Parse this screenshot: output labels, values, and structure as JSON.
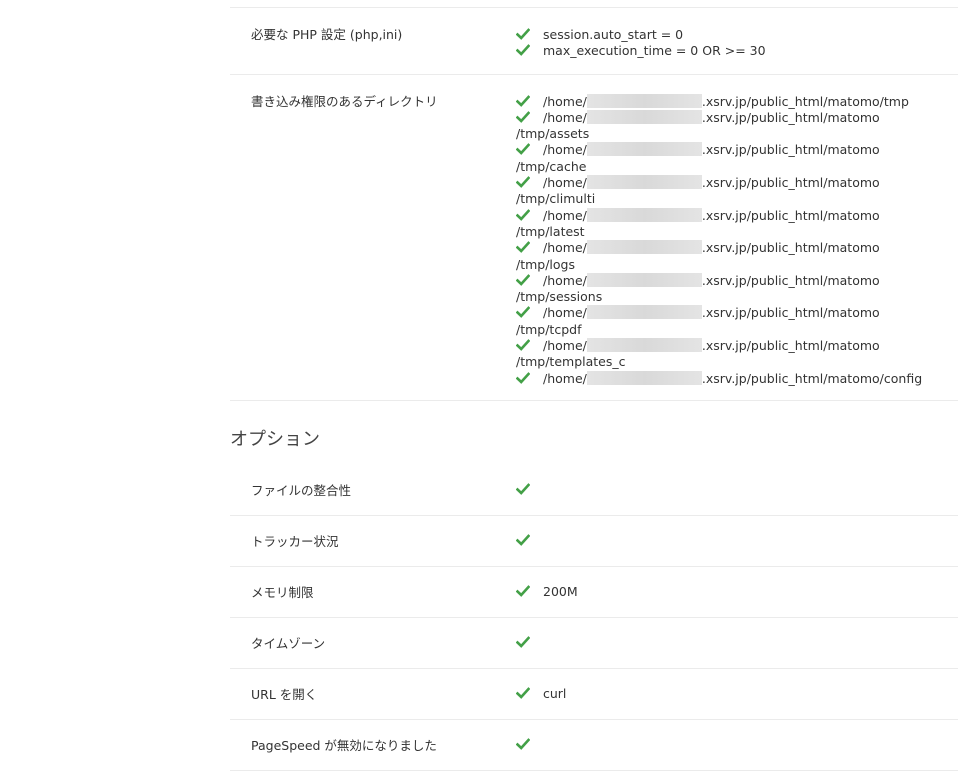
{
  "php_settings": {
    "label": "必要な PHP 設定 (php,ini)",
    "items": [
      "session.auto_start = 0",
      "max_execution_time = 0 OR >= 30"
    ]
  },
  "writable_dirs": {
    "label": "書き込み権限のあるディレクトリ",
    "prefix": "/home/",
    "items": [
      {
        "suffix": ".xsrv.jp/public_html/matomo/tmp",
        "cont": ""
      },
      {
        "suffix": ".xsrv.jp/public_html/matomo",
        "cont": "/tmp/assets"
      },
      {
        "suffix": ".xsrv.jp/public_html/matomo",
        "cont": "/tmp/cache"
      },
      {
        "suffix": ".xsrv.jp/public_html/matomo",
        "cont": "/tmp/climulti"
      },
      {
        "suffix": ".xsrv.jp/public_html/matomo",
        "cont": "/tmp/latest"
      },
      {
        "suffix": ".xsrv.jp/public_html/matomo",
        "cont": "/tmp/logs"
      },
      {
        "suffix": ".xsrv.jp/public_html/matomo",
        "cont": "/tmp/sessions"
      },
      {
        "suffix": ".xsrv.jp/public_html/matomo",
        "cont": "/tmp/tcpdf"
      },
      {
        "suffix": ".xsrv.jp/public_html/matomo",
        "cont": "/tmp/templates_c"
      },
      {
        "suffix": ".xsrv.jp/public_html/matomo/config",
        "cont": ""
      }
    ]
  },
  "options": {
    "title": "オプション",
    "rows": [
      {
        "label": "ファイルの整合性",
        "value": ""
      },
      {
        "label": "トラッカー状況",
        "value": ""
      },
      {
        "label": "メモリ制限",
        "value": "200M"
      },
      {
        "label": "タイムゾーン",
        "value": ""
      },
      {
        "label": "URL を開く",
        "value": "curl"
      },
      {
        "label": "PageSpeed が無効になりました",
        "value": ""
      }
    ]
  },
  "colors": {
    "check": "#43a047",
    "border": "#ebebeb"
  },
  "icons": {
    "status": "check-icon"
  }
}
